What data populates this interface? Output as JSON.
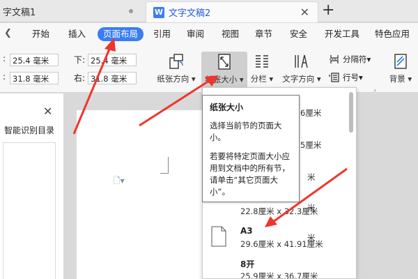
{
  "tabs": [
    {
      "label": "字文稿1"
    },
    {
      "label": "文字文稿2",
      "icon": "W"
    }
  ],
  "menu": {
    "items": [
      "开始",
      "插入",
      "页面布局",
      "引用",
      "审阅",
      "视图",
      "章节",
      "安全",
      "开发工具",
      "特色应用"
    ],
    "active": "页面布局"
  },
  "margins": {
    "top": "25.4 毫米",
    "bottom_label": "下:",
    "bottom": "25.4 毫米",
    "left": "31.8 毫米",
    "right_label": "右:",
    "right": "31.8 毫米"
  },
  "ribbon": {
    "orientation": "纸张方向",
    "paper_size": "纸张大小",
    "columns": "分栏",
    "text_direction": "文字方向",
    "separator": "分隔符",
    "line_number": "行号",
    "background": "背景"
  },
  "left_panel": {
    "title": "智能识别目录"
  },
  "tooltip": {
    "title": "纸张大小",
    "desc": "选择当前节的页面大小。",
    "note": "若要将特定页面大小应用到文档中的所有节，请单击“其它页面大小”。"
  },
  "paper_options": [
    {
      "size_fragment": "6厘米"
    },
    {
      "size_fragment": "5厘米"
    },
    {
      "size_fragment": "米"
    },
    {
      "size_fragment": "米"
    },
    {
      "size_fragment": "米"
    },
    {
      "name": "",
      "size": "22.8厘米  x  32.3厘米"
    },
    {
      "name": "A3",
      "size": "29.6厘米  x  41.91厘米"
    },
    {
      "name": "8开",
      "size": "25.9厘米  x  36.7厘米"
    }
  ],
  "annotation": {
    "color": "#f0352c"
  },
  "colors": {
    "accent": "#3a7df5"
  }
}
